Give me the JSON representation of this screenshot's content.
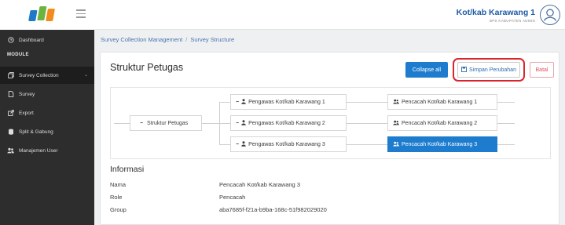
{
  "header": {
    "user_name": "Kot/kab Karawang 1",
    "user_sub": "BPS KABUPATEN ADMIN"
  },
  "sidebar": {
    "module_label": "MODULE",
    "items": [
      {
        "label": "Dashboard",
        "icon": "clock-icon"
      },
      {
        "label": "Survey Collection",
        "icon": "copy-icon"
      },
      {
        "label": "Survey",
        "icon": "file-icon"
      },
      {
        "label": "Export",
        "icon": "export-icon"
      },
      {
        "label": "Split & Gabung",
        "icon": "database-icon"
      },
      {
        "label": "Manajemen User",
        "icon": "users-icon"
      }
    ]
  },
  "breadcrumb": {
    "root": "Survey Collection Management",
    "separator": "/",
    "current": "Survey Structure"
  },
  "card": {
    "title": "Struktur Petugas",
    "collapse_label": "Collapse all",
    "save_label": "Simpan Perubahan",
    "cancel_label": "Batal"
  },
  "tree": {
    "root": "Struktur Petugas",
    "pengawas": [
      "Pengawas Kot/kab Karawang 1",
      "Pengawas Kot/kab Karawang 2",
      "Pengawas Kot/kab Karawang 3"
    ],
    "pencacah": [
      "Pencacah Kot/kab Karawang 1",
      "Pencacah Kot/kab Karawang 2",
      "Pencacah Kot/kab Karawang 3"
    ],
    "selected": "Pencacah Kot/kab Karawang 3"
  },
  "info": {
    "title": "Informasi",
    "rows": [
      {
        "label": "Nama",
        "value": "Pencacah Kot/kab Karawang 3"
      },
      {
        "label": "Role",
        "value": "Pencacah"
      },
      {
        "label": "Group",
        "value": "aba7685f-f21a-b9ba-168c-51f982029020"
      }
    ]
  },
  "colors": {
    "sidebar_bg": "#2d2d2d",
    "primary": "#1e7ccf",
    "highlight": "#d9252c",
    "danger": "#e0555d"
  }
}
